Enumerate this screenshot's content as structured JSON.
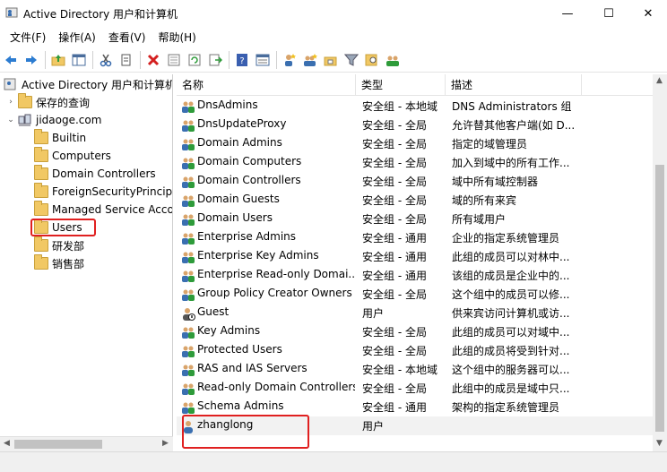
{
  "window": {
    "title": "Active Directory 用户和计算机",
    "minimize": "—",
    "maximize": "☐",
    "close": "✕"
  },
  "menu": [
    "文件(F)",
    "操作(A)",
    "查看(V)",
    "帮助(H)"
  ],
  "toolbar_icons": [
    "back-arrow-icon",
    "forward-arrow-icon",
    "up-folder-icon",
    "console-tree-icon",
    "cut-icon",
    "copy-icon",
    "delete-icon",
    "properties-icon",
    "refresh-icon",
    "export-icon",
    "help-icon",
    "details-icon",
    "new-user-icon",
    "new-group-icon",
    "new-ou-icon",
    "filter-icon",
    "find-icon",
    "add-member-icon"
  ],
  "tree": {
    "root": "Active Directory 用户和计算机",
    "saved_queries": "保存的查询",
    "domain": "jidaoge.com",
    "children": [
      "Builtin",
      "Computers",
      "Domain Controllers",
      "ForeignSecurityPrincipals",
      "Managed Service Accounts",
      "Users",
      "研发部",
      "销售部"
    ]
  },
  "list": {
    "columns": {
      "name": "名称",
      "type": "类型",
      "desc": "描述"
    },
    "rows": [
      {
        "name": "DnsAdmins",
        "type": "安全组 - 本地域",
        "desc": "DNS Administrators 组",
        "kind": "group"
      },
      {
        "name": "DnsUpdateProxy",
        "type": "安全组 - 全局",
        "desc": "允许替其他客户端(如 D...",
        "kind": "group"
      },
      {
        "name": "Domain Admins",
        "type": "安全组 - 全局",
        "desc": "指定的域管理员",
        "kind": "group"
      },
      {
        "name": "Domain Computers",
        "type": "安全组 - 全局",
        "desc": "加入到域中的所有工作...",
        "kind": "group"
      },
      {
        "name": "Domain Controllers",
        "type": "安全组 - 全局",
        "desc": "域中所有域控制器",
        "kind": "group"
      },
      {
        "name": "Domain Guests",
        "type": "安全组 - 全局",
        "desc": "域的所有来宾",
        "kind": "group"
      },
      {
        "name": "Domain Users",
        "type": "安全组 - 全局",
        "desc": "所有域用户",
        "kind": "group"
      },
      {
        "name": "Enterprise Admins",
        "type": "安全组 - 通用",
        "desc": "企业的指定系统管理员",
        "kind": "group"
      },
      {
        "name": "Enterprise Key Admins",
        "type": "安全组 - 通用",
        "desc": "此组的成员可以对林中...",
        "kind": "group"
      },
      {
        "name": "Enterprise Read-only Domai...",
        "type": "安全组 - 通用",
        "desc": "该组的成员是企业中的...",
        "kind": "group"
      },
      {
        "name": "Group Policy Creator Owners",
        "type": "安全组 - 全局",
        "desc": "这个组中的成员可以修...",
        "kind": "group"
      },
      {
        "name": "Guest",
        "type": "用户",
        "desc": "供来宾访问计算机或访...",
        "kind": "disabled-user"
      },
      {
        "name": "Key Admins",
        "type": "安全组 - 全局",
        "desc": "此组的成员可以对域中...",
        "kind": "group"
      },
      {
        "name": "Protected Users",
        "type": "安全组 - 全局",
        "desc": "此组的成员将受到针对...",
        "kind": "group"
      },
      {
        "name": "RAS and IAS Servers",
        "type": "安全组 - 本地域",
        "desc": "这个组中的服务器可以...",
        "kind": "group"
      },
      {
        "name": "Read-only Domain Controllers",
        "type": "安全组 - 全局",
        "desc": "此组中的成员是域中只...",
        "kind": "group"
      },
      {
        "name": "Schema Admins",
        "type": "安全组 - 通用",
        "desc": "架构的指定系统管理员",
        "kind": "group"
      },
      {
        "name": "zhanglong",
        "type": "用户",
        "desc": "",
        "kind": "user"
      }
    ]
  },
  "colors": {
    "highlight": "#e02020",
    "folder": "#f1c864"
  }
}
